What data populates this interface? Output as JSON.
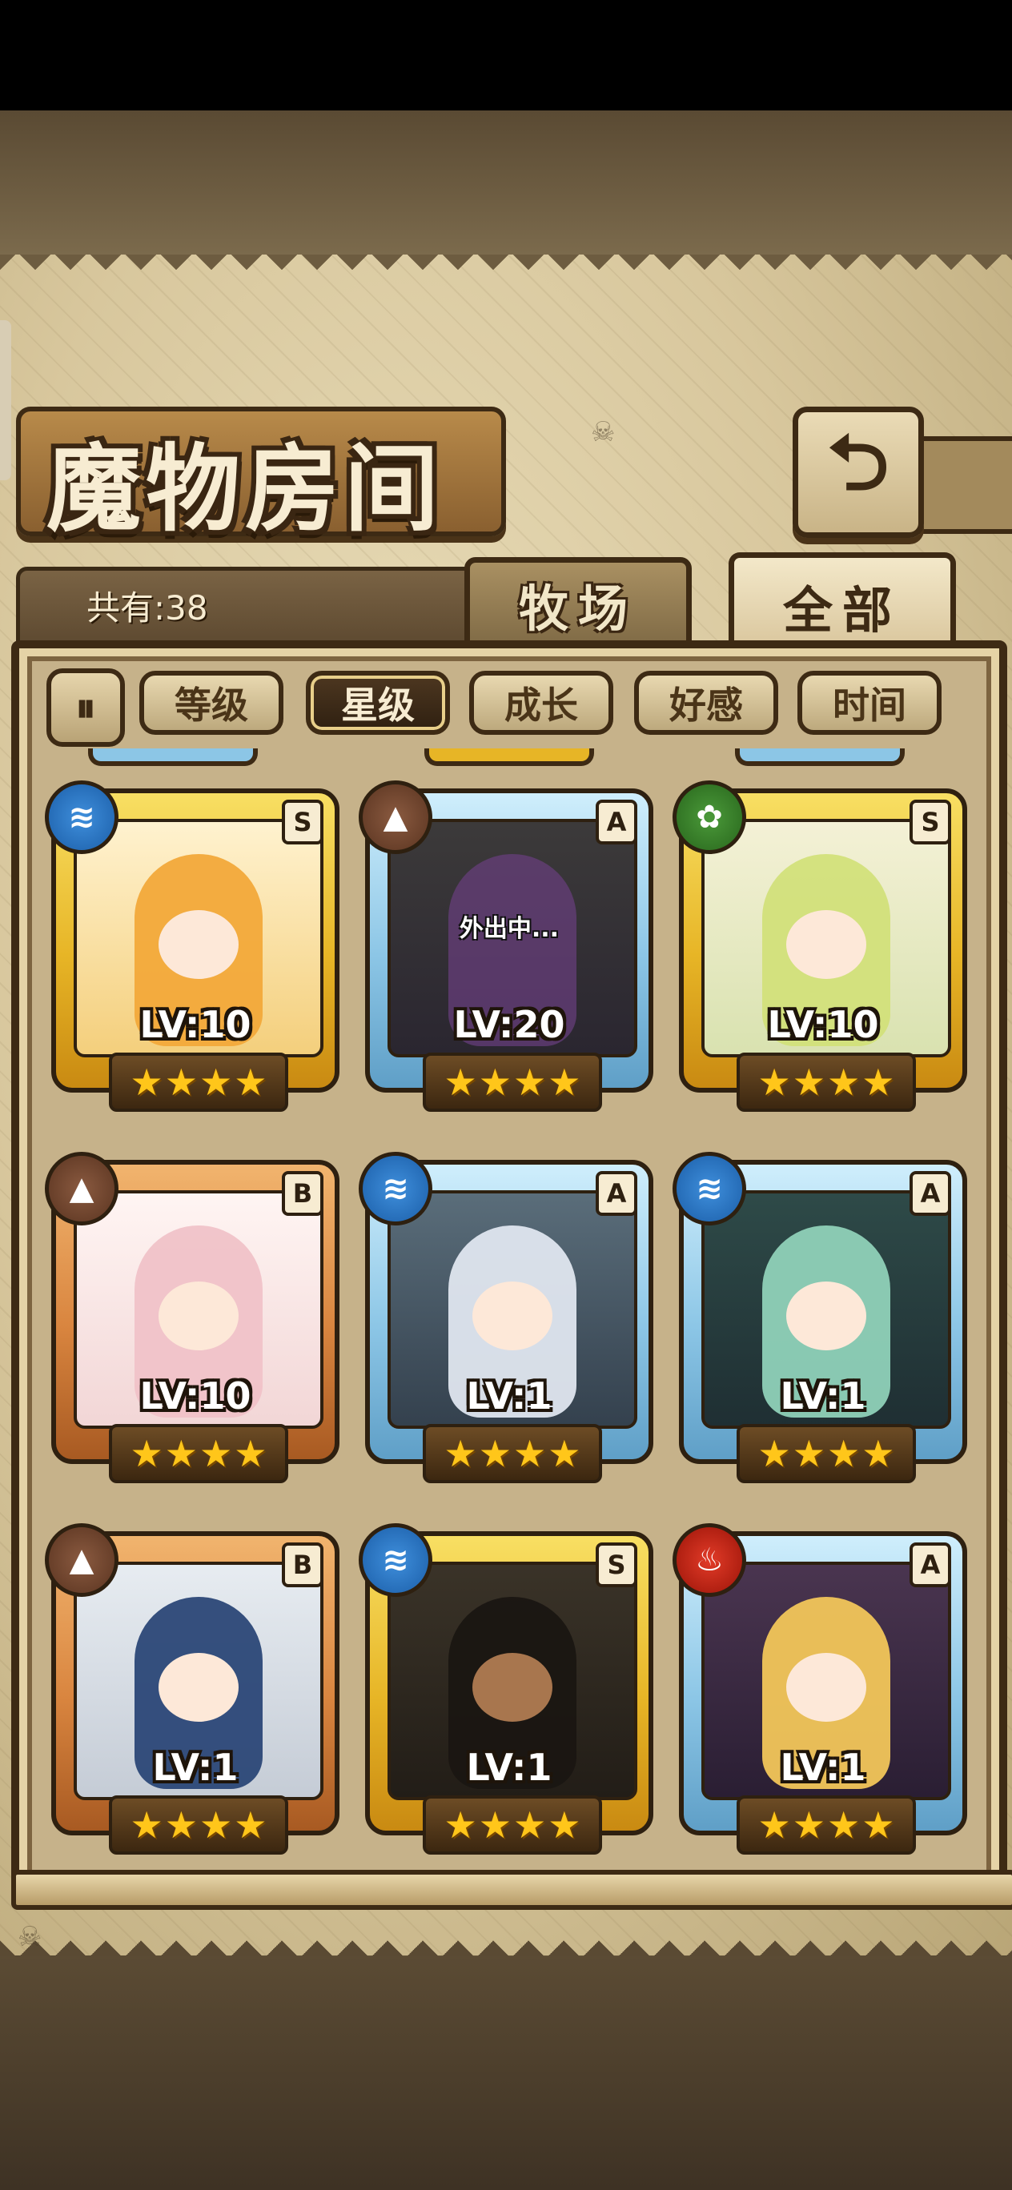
{
  "title": "魔物房间",
  "count_label": "共有:38",
  "tabs": [
    {
      "label": "牧场",
      "active": false
    },
    {
      "label": "全部",
      "active": true
    }
  ],
  "sort_toggle_icon": "pause-sort-icon",
  "sort_buttons": [
    {
      "label": "等级",
      "active": false
    },
    {
      "label": "星级",
      "active": true
    },
    {
      "label": "成长",
      "active": false
    },
    {
      "label": "好感",
      "active": false
    },
    {
      "label": "时间",
      "active": false
    }
  ],
  "cards": [
    {
      "grade": "S",
      "element": "water",
      "level": "LV:10",
      "stars": 4,
      "frame": "gold",
      "status": ""
    },
    {
      "grade": "A",
      "element": "earth",
      "level": "LV:20",
      "stars": 4,
      "frame": "blue",
      "status": "外出中..."
    },
    {
      "grade": "S",
      "element": "leaf",
      "level": "LV:10",
      "stars": 4,
      "frame": "gold",
      "status": ""
    },
    {
      "grade": "B",
      "element": "earth",
      "level": "LV:10",
      "stars": 4,
      "frame": "bronze",
      "status": ""
    },
    {
      "grade": "A",
      "element": "water",
      "level": "LV:1",
      "stars": 4,
      "frame": "blue",
      "status": ""
    },
    {
      "grade": "A",
      "element": "water",
      "level": "LV:1",
      "stars": 4,
      "frame": "blue",
      "status": ""
    },
    {
      "grade": "B",
      "element": "earth",
      "level": "LV:1",
      "stars": 4,
      "frame": "bronze",
      "status": ""
    },
    {
      "grade": "S",
      "element": "water",
      "level": "LV:1",
      "stars": 4,
      "frame": "gold",
      "status": ""
    },
    {
      "grade": "A",
      "element": "fire",
      "level": "LV:1",
      "stars": 4,
      "frame": "blue",
      "status": ""
    }
  ]
}
